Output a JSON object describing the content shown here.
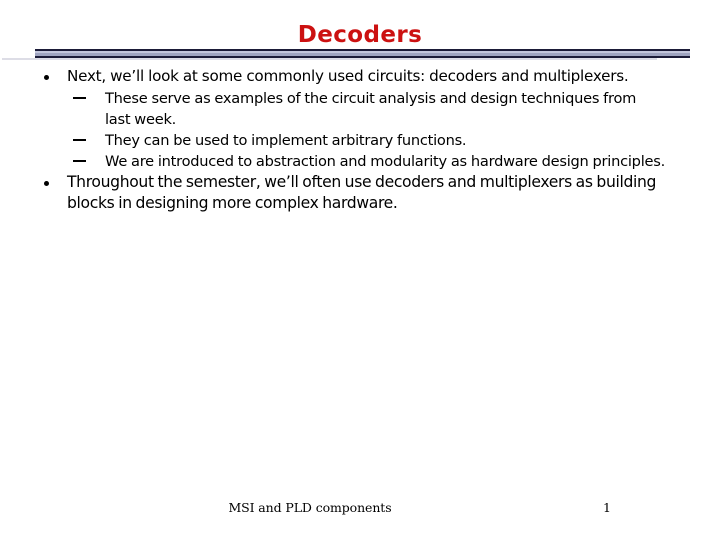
{
  "slide": {
    "title": "Decoders",
    "title_color": "#CC1111",
    "background_color": "#ffffff",
    "rule_fill_color": "#9FA4C0",
    "rule_border_color": "#1B1B38"
  },
  "body": {
    "bullets": [
      {
        "level": 1,
        "marker": "filled-circle",
        "text": "Next, we’ll look at some commonly used circuits: decoders and multiplexers."
      },
      {
        "level": 2,
        "marker": "en-dash",
        "text": "These serve as examples of the circuit analysis and design techniques from last week."
      },
      {
        "level": 2,
        "marker": "en-dash",
        "text": "They can be used to implement arbitrary functions."
      },
      {
        "level": 2,
        "marker": "en-dash",
        "text": "We are introduced to abstraction and modularity as hardware design principles."
      },
      {
        "level": 1,
        "marker": "filled-circle",
        "text": "Throughout the semester, we’ll often use decoders and multiplexers as building blocks in designing more complex hardware."
      }
    ]
  },
  "footer": {
    "label": "MSI and PLD components",
    "page_number": "1"
  }
}
